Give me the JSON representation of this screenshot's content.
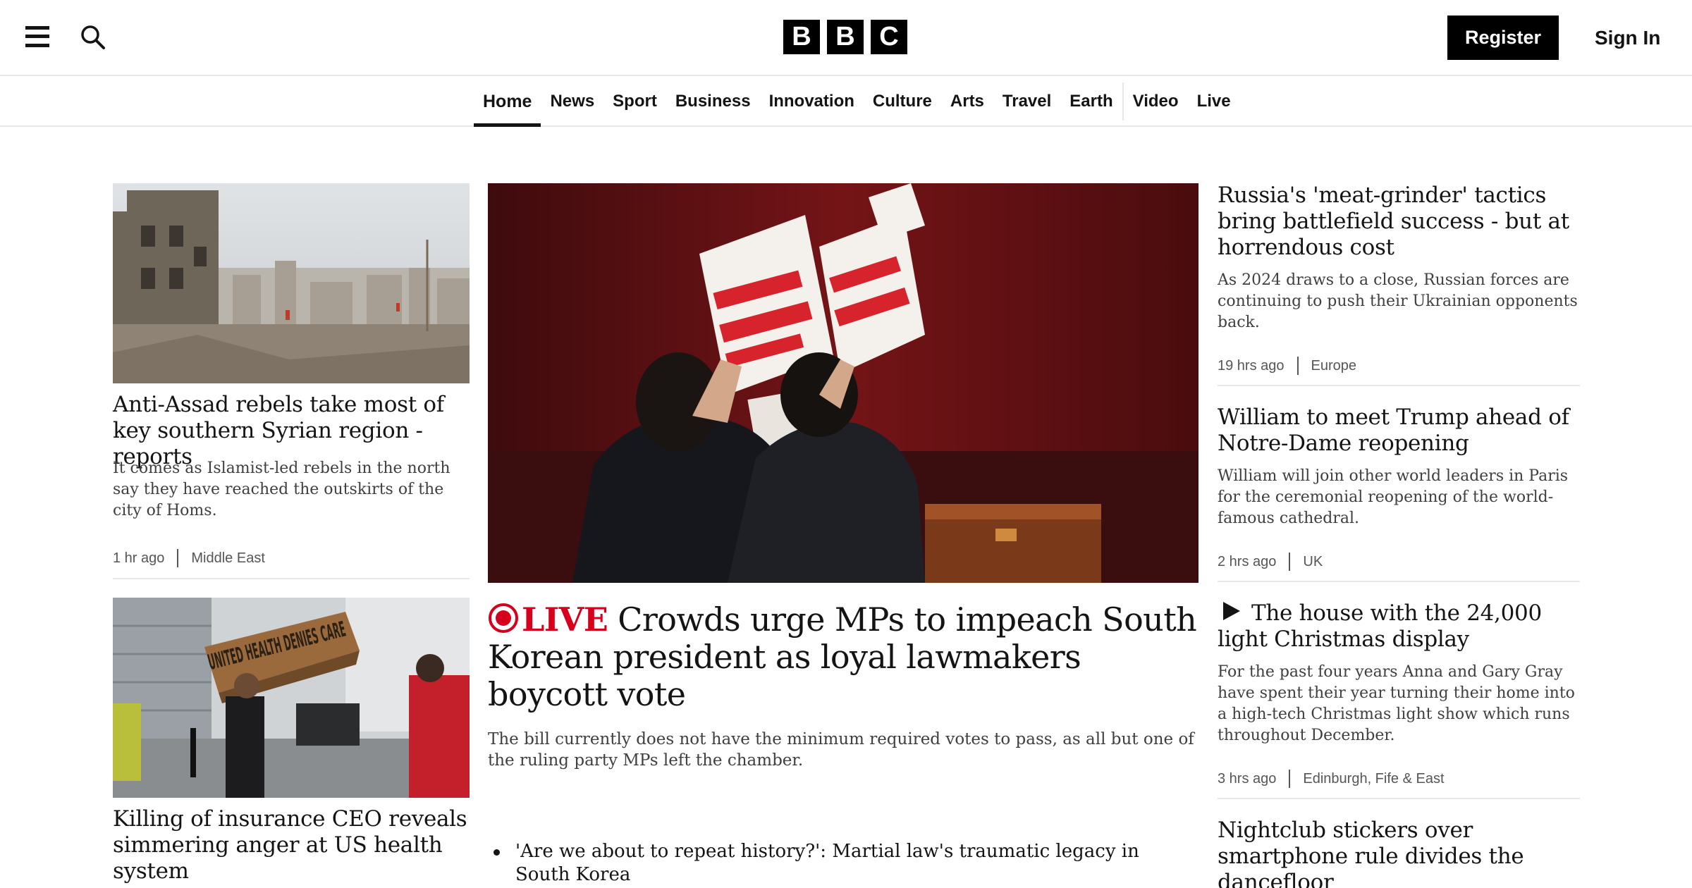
{
  "header": {
    "logo_letters": [
      "B",
      "B",
      "C"
    ],
    "register_label": "Register",
    "signin_label": "Sign In"
  },
  "nav": {
    "items": [
      "Home",
      "News",
      "Sport",
      "Business",
      "Innovation",
      "Culture",
      "Arts",
      "Travel",
      "Earth",
      "Video",
      "Live"
    ],
    "active": "Home"
  },
  "left_stories": [
    {
      "headline": "Anti-Assad rebels take most of key southern Syrian region - reports",
      "summary": "It comes as Islamist-led rebels in the north say they have reached the outskirts of the city of Homs.",
      "time": "1 hr ago",
      "section": "Middle East"
    },
    {
      "headline": "Killing of insurance CEO reveals simmering anger at US health system",
      "image_text": "UNITED HEALTH DENIES CARE"
    }
  ],
  "main_story": {
    "live_label": "LIVE",
    "headline": "Crowds urge MPs to impeach South Korean president as loyal lawmakers boycott vote",
    "summary": "The bill currently does not have the minimum required votes to pass, as all but one of the ruling party MPs left the chamber.",
    "related": [
      "'Are we about to repeat history?': Martial law's traumatic legacy in South Korea"
    ]
  },
  "right_stories": [
    {
      "headline": "Russia's 'meat-grinder' tactics bring battlefield success - but at horrendous cost",
      "summary": "As 2024 draws to a close, Russian forces are continuing to push their Ukrainian opponents back.",
      "time": "19 hrs ago",
      "section": "Europe"
    },
    {
      "headline": "William to meet Trump ahead of Notre-Dame reopening",
      "summary": "William will join other world leaders in Paris for the ceremonial reopening of the world-famous cathedral.",
      "time": "2 hrs ago",
      "section": "UK"
    },
    {
      "headline": "The house with the 24,000 light Christmas display",
      "summary": "For the past four years Anna and Gary Gray have spent their year turning their home into a high-tech Christmas light show which runs throughout December.",
      "time": "3 hrs ago",
      "section": "Edinburgh, Fife & East"
    },
    {
      "headline": "Nightclub stickers over smartphone rule divides the dancefloor"
    }
  ],
  "icons": {
    "menu": "hamburger-menu-icon",
    "search": "search-icon",
    "live": "live-indicator-icon",
    "play": "play-icon"
  },
  "colors": {
    "live_red": "#d6001c",
    "text": "#141414",
    "muted": "#545658"
  }
}
